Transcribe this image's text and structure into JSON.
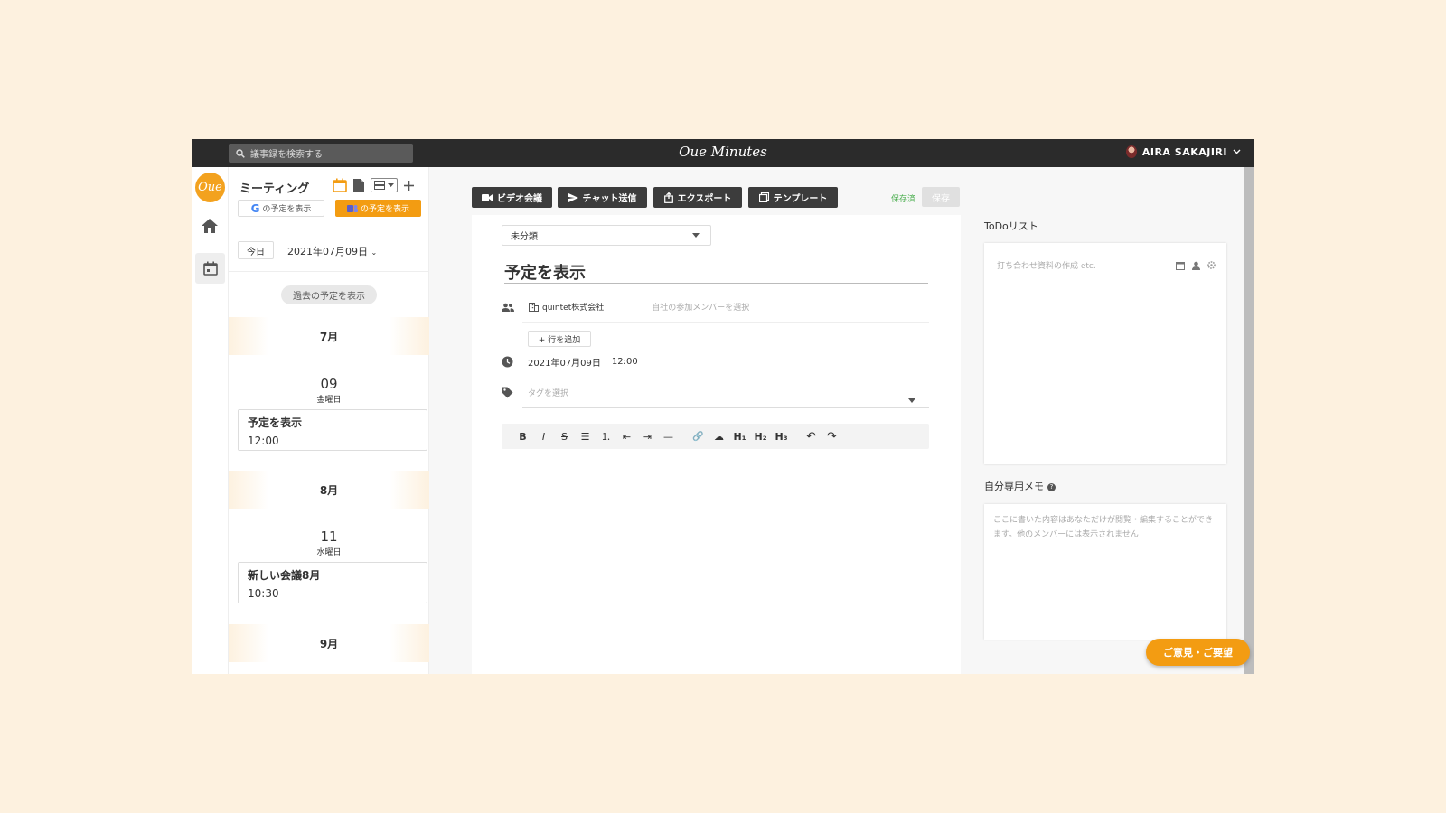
{
  "topbar": {
    "search_placeholder": "議事録を検索する",
    "brand": "Oue Minutes",
    "user_name": "AIRA SAKAJIRI"
  },
  "rail": {
    "logo": "Oue"
  },
  "panel": {
    "title": "ミーティング",
    "google_label": "の予定を表示",
    "teams_label": "の予定を表示",
    "today": "今日",
    "date": "2021年07月09日",
    "past_label": "過去の予定を表示",
    "months": [
      {
        "label": "7月",
        "day": "09",
        "weekday": "金曜日",
        "event_title": "予定を表示",
        "event_time": "12:00"
      },
      {
        "label": "8月",
        "day": "11",
        "weekday": "水曜日",
        "event_title": "新しい会議8月",
        "event_time": "10:30"
      },
      {
        "label": "9月"
      }
    ]
  },
  "toolbar": {
    "video": "ビデオ会議",
    "chat": "チャット送信",
    "export": "エクスポート",
    "template": "テンプレート",
    "saved": "保存済",
    "save": "保存"
  },
  "doc": {
    "category": "未分類",
    "title": "予定を表示",
    "company": "quintet株式会社",
    "member_placeholder": "自社の参加メンバーを選択",
    "add_row": "+ 行を追加",
    "date": "2021年07月09日",
    "time": "12:00",
    "tag_placeholder": "タグを選択",
    "rte": [
      "B",
      "I",
      "S",
      "☰",
      "⒈",
      "⇤",
      "⇥",
      "—",
      "🔗",
      "☁",
      "H₁",
      "H₂",
      "H₃",
      "↶",
      "↷"
    ]
  },
  "right": {
    "todo_label": "ToDoリスト",
    "todo_placeholder": "打ち合わせ資料の作成 etc.",
    "memo_label": "自分専用メモ",
    "memo_placeholder": "ここに書いた内容はあなただけが閲覧・編集することができます。他のメンバーには表示されません",
    "feedback": "ご意見・ご要望"
  },
  "colors": {
    "accent": "#f39c12",
    "topbar": "#2b2b2b",
    "background": "#fdf1df"
  }
}
